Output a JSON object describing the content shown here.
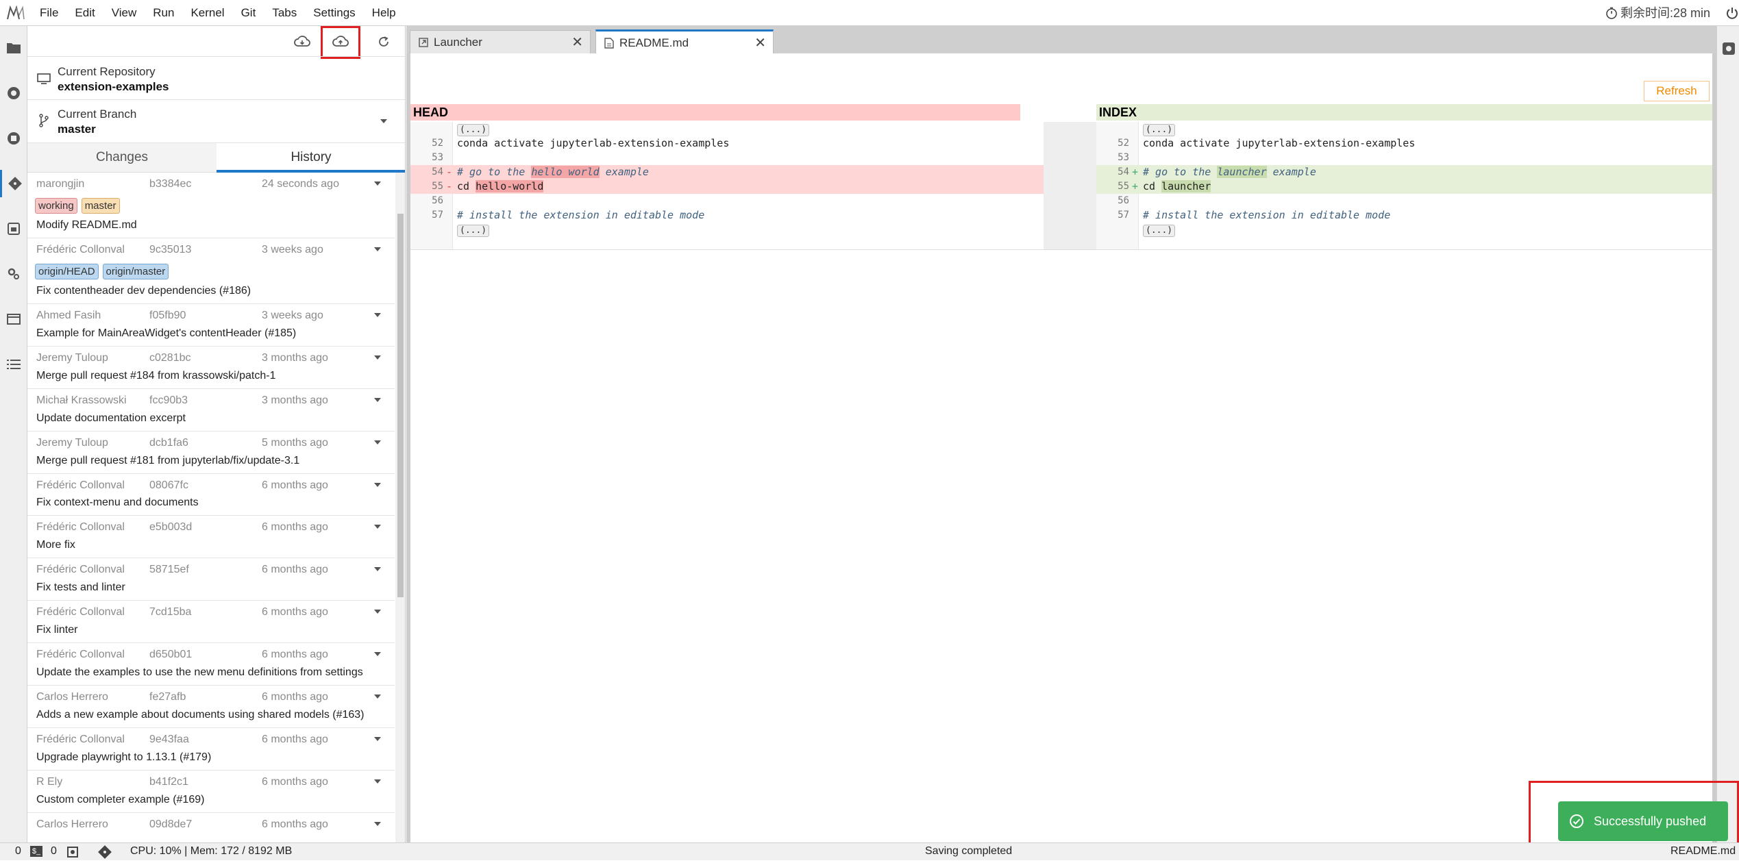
{
  "menubar": {
    "items": [
      "File",
      "Edit",
      "View",
      "Run",
      "Kernel",
      "Git",
      "Tabs",
      "Settings",
      "Help"
    ],
    "timer": "剩余时间:28 min"
  },
  "git": {
    "repo_label": "Current Repository",
    "repo_name": "extension-examples",
    "branch_label": "Current Branch",
    "branch_name": "master",
    "tabs": [
      "Changes",
      "History"
    ],
    "commits": [
      {
        "author": "marongjin",
        "hash": "b3384ec",
        "time": "24 seconds ago",
        "tags": [
          "working",
          "master"
        ],
        "message": "Modify README.md"
      },
      {
        "author": "Frédéric Collonval",
        "hash": "9c35013",
        "time": "3 weeks ago",
        "tags": [
          "origin/HEAD",
          "origin/master"
        ],
        "message": "Fix contentheader dev dependencies (#186)"
      },
      {
        "author": "Ahmed Fasih",
        "hash": "f05fb90",
        "time": "3 weeks ago",
        "tags": [],
        "message": "Example for MainAreaWidget's contentHeader (#185)"
      },
      {
        "author": "Jeremy Tuloup",
        "hash": "c0281bc",
        "time": "3 months ago",
        "tags": [],
        "message": "Merge pull request #184 from krassowski/patch-1"
      },
      {
        "author": "Michał Krassowski",
        "hash": "fcc90b3",
        "time": "3 months ago",
        "tags": [],
        "message": "Update documentation excerpt"
      },
      {
        "author": "Jeremy Tuloup",
        "hash": "dcb1fa6",
        "time": "5 months ago",
        "tags": [],
        "message": "Merge pull request #181 from jupyterlab/fix/update-3.1"
      },
      {
        "author": "Frédéric Collonval",
        "hash": "08067fc",
        "time": "6 months ago",
        "tags": [],
        "message": "Fix context-menu and documents"
      },
      {
        "author": "Frédéric Collonval",
        "hash": "e5b003d",
        "time": "6 months ago",
        "tags": [],
        "message": "More fix"
      },
      {
        "author": "Frédéric Collonval",
        "hash": "58715ef",
        "time": "6 months ago",
        "tags": [],
        "message": "Fix tests and linter"
      },
      {
        "author": "Frédéric Collonval",
        "hash": "7cd15ba",
        "time": "6 months ago",
        "tags": [],
        "message": "Fix linter"
      },
      {
        "author": "Frédéric Collonval",
        "hash": "d650b01",
        "time": "6 months ago",
        "tags": [],
        "message": "Update the examples to use the new menu definitions from settings"
      },
      {
        "author": "Carlos Herrero",
        "hash": "fe27afb",
        "time": "6 months ago",
        "tags": [],
        "message": "Adds a new example about documents using shared models (#163)"
      },
      {
        "author": "Frédéric Collonval",
        "hash": "9e43faa",
        "time": "6 months ago",
        "tags": [],
        "message": "Upgrade playwright to 1.13.1 (#179)"
      },
      {
        "author": "R Ely",
        "hash": "b41f2c1",
        "time": "6 months ago",
        "tags": [],
        "message": "Custom completer example (#169)"
      },
      {
        "author": "Carlos Herrero",
        "hash": "09d8de7",
        "time": "6 months ago",
        "tags": [],
        "message": ""
      }
    ]
  },
  "main": {
    "tabs": [
      "Launcher",
      "README.md"
    ],
    "refresh_label": "Refresh",
    "diff": {
      "left_header": "HEAD",
      "right_header": "INDEX",
      "fold": "(...)",
      "left": {
        "l52": "conda activate jupyterlab-extension-examples",
        "l54_pre": "# go to the ",
        "l54_hl": "hello world",
        "l54_post": " example",
        "l55_pre": "cd ",
        "l55_hl": "hello-world",
        "l57": "# install the extension in editable mode"
      },
      "right": {
        "l52": "conda activate jupyterlab-extension-examples",
        "l54_pre": "# go to the ",
        "l54_hl": "launcher",
        "l54_post": " example",
        "l55_pre": "cd ",
        "l55_hl": "launcher",
        "l57": "# install the extension in editable mode"
      },
      "line_numbers": [
        "52",
        "53",
        "54",
        "55",
        "56",
        "57"
      ],
      "del_marker": "-",
      "add_marker": "+"
    }
  },
  "toast": {
    "message": "Successfully pushed"
  },
  "status": {
    "zero_a": "0",
    "zero_b": "0",
    "cpu_mem": "CPU: 10% | Mem: 172 / 8192 MB",
    "saving": "Saving completed",
    "file": "README.md"
  },
  "colors": {
    "accent": "#1f78c8",
    "deleted_bg": "#ffd6d6",
    "added_bg": "#e6f0d8",
    "toast_bg": "#3dae5a",
    "highlight_frame": "#e02020"
  }
}
